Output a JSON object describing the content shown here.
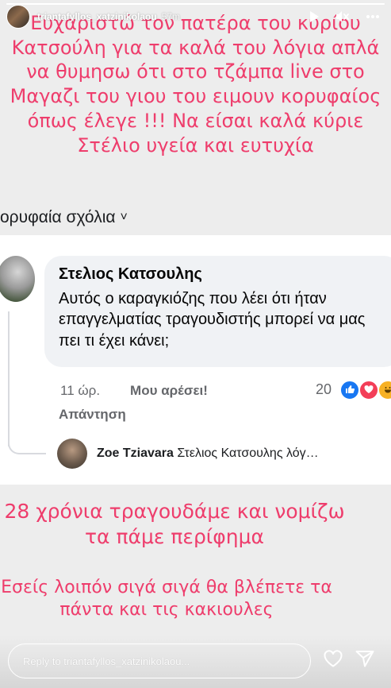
{
  "header": {
    "username": "triantafyllos_xatzinikolaou",
    "time_ago": "57m"
  },
  "progress": {
    "fraction": 1.0
  },
  "overlay": {
    "top_text": "Ευχαριστώ τον πατέρα του κυρίου Κατσούλη για τα καλά του λόγια απλά να θυμησω ότι στο τζάμπα live στο Μαγαζι του γιου του ειμουν κορυφαίος όπως έλεγε !!! Να είσαι καλά κύριε Στέλιο υγεία και ευτυχία",
    "middle_text": "28 χρόνια τραγουδάμε και νομίζω τα πάμε περίφημα",
    "bottom_text": "Εσείς λοιπόν σιγά σιγά θα βλέπετε τα πάντα και τις κακιουλες"
  },
  "fb_comment": {
    "section_label": "ορυφαία σχόλια",
    "section_chevron": "˅",
    "author": "Στελιος Κατσουλης",
    "text": "Αυτός ο καραγκιόζης που λέει ότι ήταν επαγγελματίας τραγουδιστής μπορεί να μας πει τι έχει κάνει;",
    "time": "11 ώρ.",
    "like_action": "Μου αρέσει!",
    "reply_action": "Απάντηση",
    "reaction_count": "20",
    "reactions": [
      "like-icon",
      "love-icon",
      "haha-icon"
    ],
    "reply_author": "Zoe Tziavara",
    "reply_snippet": "Στελιος Κατσουλης λόγ…"
  },
  "reply_bar": {
    "placeholder": "Reply to triantafyllos_xatzinikolaou..."
  },
  "colors": {
    "overlay_text": "#ee3d6c",
    "fb_like": "#1877f2",
    "fb_love": "#f33e58",
    "fb_haha": "#f7b125"
  }
}
